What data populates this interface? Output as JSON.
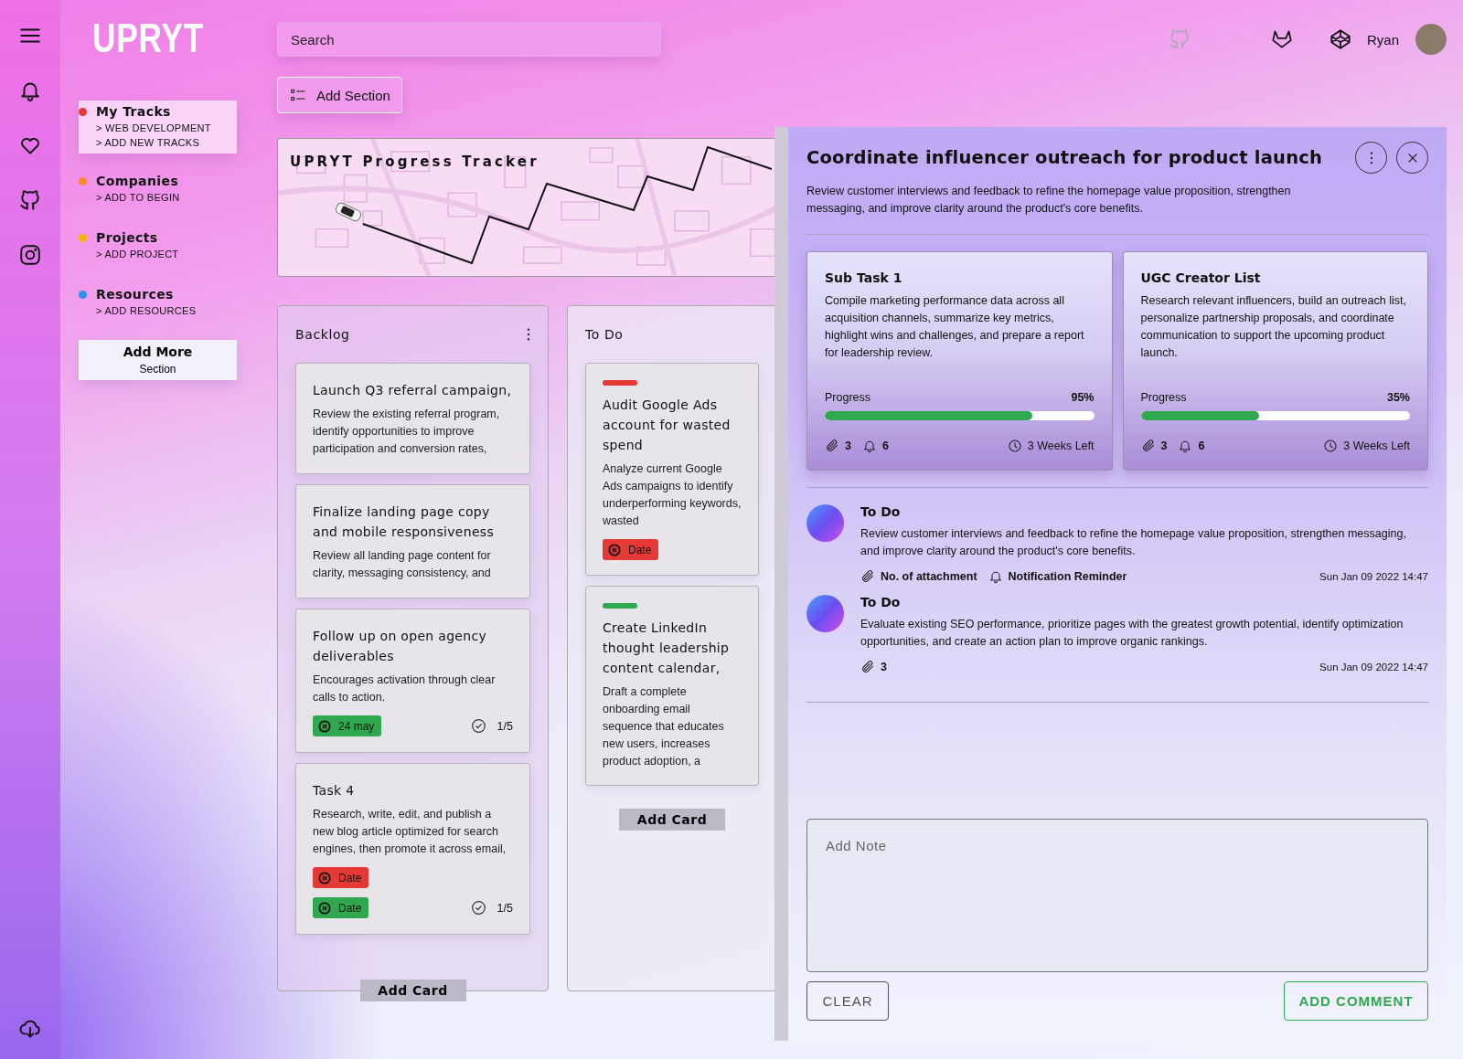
{
  "logo": "UPRYT",
  "search": {
    "placeholder": "Search"
  },
  "add_section_button": "Add Section",
  "user": {
    "name": "Ryan"
  },
  "nav": [
    {
      "title": "My Tracks",
      "color": "#e53935",
      "selected": true,
      "links": [
        "> WEB DEVELOPMENT",
        "> ADD NEW TRACKS"
      ]
    },
    {
      "title": "Companies",
      "color": "#fb8c2e",
      "selected": false,
      "links": [
        "> ADD TO BEGIN"
      ]
    },
    {
      "title": "Projects",
      "color": "#f5b400",
      "selected": false,
      "links": [
        "> ADD PROJECT"
      ]
    },
    {
      "title": "Resources",
      "color": "#2f8ff0",
      "selected": false,
      "links": [
        "> ADD RESOURCES"
      ]
    }
  ],
  "add_more": {
    "title": "Add More",
    "subtitle": "Section"
  },
  "tracker": {
    "title": "UPRYT Progress Tracker"
  },
  "columns": [
    {
      "title": "Backlog",
      "menu": true,
      "add_card": "Add Card",
      "cards": [
        {
          "title": "Launch Q3 referral campaign,",
          "text": "Review the existing referral program, identify opportunities to improve participation and conversion rates,"
        },
        {
          "title": "Finalize landing page copy and mobile responsiveness",
          "text": "Review all landing page content for clarity, messaging consistency, and"
        },
        {
          "title": "Follow up on open agency deliverables",
          "text": "Encourages activation through clear calls to action.",
          "badges": [
            {
              "text": "24 may",
              "color": "#2fa84f"
            }
          ],
          "checklist": "1/5"
        },
        {
          "title": "Task 4",
          "text": "Research, write, edit, and publish a new blog article optimized for search engines, then promote it across email,",
          "badges": [
            {
              "text": "Date",
              "color": "#e53935"
            },
            {
              "text": "Date",
              "color": "#2fa84f"
            }
          ],
          "checklist": "1/5"
        }
      ]
    },
    {
      "title": "To Do",
      "menu": false,
      "add_card": "Add Card",
      "cards": [
        {
          "color": "#e53935",
          "title": "Audit Google Ads account for wasted spend",
          "text": "Analyze current Google Ads campaigns to identify underperforming keywords, wasted",
          "badges": [
            {
              "text": "Date",
              "color": "#e53935"
            }
          ]
        },
        {
          "color": "#2fa84f",
          "title": "Create LinkedIn thought leadership content calendar,",
          "text": "Draft a complete onboarding email sequence that educates new users, increases product adoption, a"
        }
      ]
    }
  ],
  "panel": {
    "title": "Coordinate influencer outreach for product launch",
    "description": "Review customer interviews and feedback to refine the homepage value proposition, strengthen messaging, and improve clarity around the product's core benefits.",
    "subtasks": [
      {
        "title": "Sub Task 1",
        "text": "Compile marketing performance data across all acquisition channels, summarize key metrics, highlight wins and challenges, and prepare a report for leadership review.",
        "progress_label": "Progress",
        "percent": "95%",
        "level": 0.77,
        "attachments": "3",
        "reminders": "6",
        "time_left": "3 Weeks Left"
      },
      {
        "title": "UGC Creator List",
        "text": "Research relevant influencers, build an outreach list, personalize partnership proposals, and coordinate communication to support the upcoming product launch.",
        "progress_label": "Progress",
        "percent": "35%",
        "level": 0.44,
        "attachments": "3",
        "reminders": "6",
        "time_left": "3 Weeks Left"
      }
    ],
    "comments": [
      {
        "title": "To Do",
        "text": "Review customer interviews and feedback to refine the homepage value proposition, strengthen messaging, and improve clarity around the product's core benefits.",
        "meta": [
          {
            "kind": "attachment",
            "text": "No. of attachment"
          },
          {
            "kind": "reminder",
            "text": "Notification Reminder"
          }
        ],
        "date": "Sun Jan 09 2022 14:47"
      },
      {
        "title": "To Do",
        "text": "Evaluate existing SEO performance, prioritize pages with the greatest growth potential, identify optimization opportunities, and create an action plan to improve organic rankings.",
        "meta": [
          {
            "kind": "attachment",
            "text": "3"
          }
        ],
        "date": "Sun Jan 09 2022 14:47"
      }
    ],
    "note": {
      "placeholder": "Add Note"
    },
    "clear_button": "CLEAR",
    "add_comment_button": "ADD COMMENT"
  }
}
